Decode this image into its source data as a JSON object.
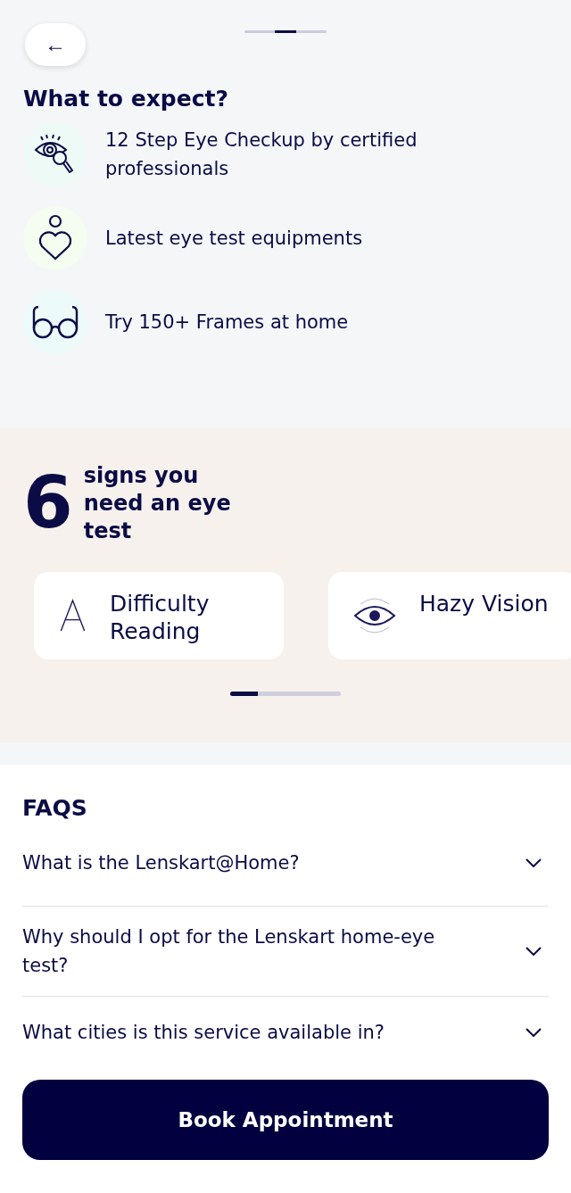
{
  "back_button": {
    "label": "←"
  },
  "expect": {
    "title": "What to expect?",
    "items": [
      {
        "kind": "checkup",
        "text": "12 Step Eye Checkup by certified professionals",
        "color": "#eefaf5"
      },
      {
        "kind": "equipment",
        "text": "Latest eye test equipments",
        "color": "#f5fcf0"
      },
      {
        "kind": "frames",
        "text": "Try 150+ Frames at home",
        "color": "#ecfafa"
      }
    ]
  },
  "signs": {
    "number": "6",
    "title": "signs you need an eye test",
    "cards": [
      {
        "kind": "reading",
        "text": "Difficulty Reading"
      },
      {
        "kind": "hazy",
        "text": "Hazy Vision"
      }
    ],
    "pager": {
      "level": 0.25
    }
  },
  "faqs": {
    "title": "FAQS",
    "items": [
      {
        "question": "What is the Lenskart@Home?",
        "expanded": false
      },
      {
        "question": "Why should I opt for the Lenskart home-eye test?",
        "expanded": false
      },
      {
        "question": "What cities is this service available in?",
        "expanded": false
      }
    ]
  },
  "cta": {
    "label": "Book Appointment"
  }
}
